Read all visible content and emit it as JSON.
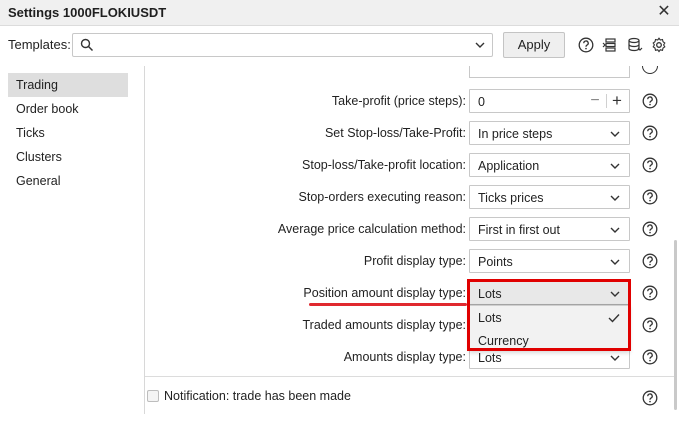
{
  "window": {
    "title": "Settings 1000FLOKIUSDT"
  },
  "templates": {
    "label": "Templates:",
    "value": "",
    "apply_label": "Apply"
  },
  "sidebar": {
    "items": [
      {
        "label": "Trading",
        "active": true
      },
      {
        "label": "Order book",
        "active": false
      },
      {
        "label": "Ticks",
        "active": false
      },
      {
        "label": "Clusters",
        "active": false
      },
      {
        "label": "General",
        "active": false
      }
    ]
  },
  "settings": {
    "take_profit_steps": {
      "label": "Take-profit (price steps):",
      "value": "0"
    },
    "set_sl_tp": {
      "label": "Set Stop-loss/Take-Profit:",
      "value": "In price steps"
    },
    "sl_tp_location": {
      "label": "Stop-loss/Take-profit location:",
      "value": "Application"
    },
    "stop_orders_reason": {
      "label": "Stop-orders executing reason:",
      "value": "Ticks prices"
    },
    "avg_price_method": {
      "label": "Average price calculation method:",
      "value": "First in first out"
    },
    "profit_display": {
      "label": "Profit display type:",
      "value": "Points"
    },
    "position_amount_display": {
      "label": "Position amount display type:",
      "value": "Lots"
    },
    "traded_amounts_display": {
      "label": "Traded amounts display type:",
      "value": ""
    },
    "amounts_display": {
      "label": "Amounts display type:",
      "value": "Lots"
    }
  },
  "dropdown": {
    "options": [
      {
        "label": "Lots",
        "selected": true
      },
      {
        "label": "Currency",
        "selected": false
      }
    ]
  },
  "notification": {
    "label": "Notification: trade has been made",
    "checked": false
  },
  "colors": {
    "highlight": "#e00000",
    "underline": "#e0292f",
    "active_item_bg": "#dedede"
  },
  "icons": [
    "close-icon",
    "search-icon",
    "chevron-down-icon",
    "help-icon",
    "layers-icon",
    "database-icon",
    "gear-icon",
    "check-icon"
  ]
}
